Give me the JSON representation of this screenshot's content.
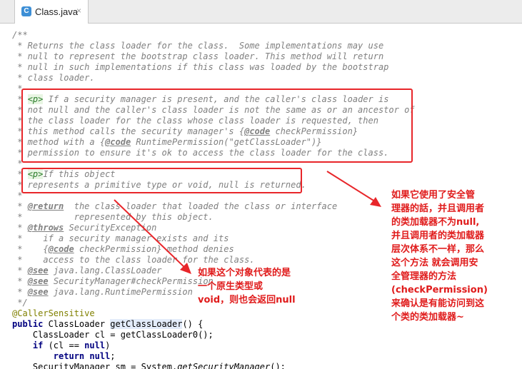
{
  "tab": {
    "label": "Class.java",
    "icon": "java-class-icon",
    "close": "×"
  },
  "code": {
    "l01": "/**",
    "l02": " * Returns the class loader for the class.  Some implementations may use",
    "l03": " * null to represent the bootstrap class loader. This method will return",
    "l04": " * null in such implementations if this class was loaded by the bootstrap",
    "l05": " * class loader.",
    "l06": " *",
    "l07a": " * ",
    "l07tag": "<p>",
    "l07b": " If a security manager is present, and the caller's class loader is",
    "l08": " * not null and the caller's class loader is not the same as or an ancestor of",
    "l09": " * the class loader for the class whose class loader is requested, then",
    "l10a": " * this method calls the security manager's {",
    "l10tag": "@code",
    "l10b": " checkPermission}",
    "l11a": " * method with a {",
    "l11tag": "@code",
    "l11b": " RuntimePermission(\"getClassLoader\")}",
    "l12": " * permission to ensure it's ok to access the class loader for the class.",
    "l13": " *",
    "l14a": " * ",
    "l14tag": "<p>",
    "l14b": "If this object",
    "l15": " * represents a primitive type or void, null is returned.",
    "l16": " *",
    "l17a": " * ",
    "l17tag": "@return",
    "l17b": "  the class loader that loaded the class or interface",
    "l18": " *          represented by this object.",
    "l19a": " * ",
    "l19tag": "@throws",
    "l19b": " SecurityException",
    "l20": " *    if a security manager exists and its",
    "l21a": " *    {",
    "l21tag": "@code",
    "l21b": " checkPermission} method denies",
    "l22": " *    access to the class loader for the class.",
    "l23a": " * ",
    "l23tag": "@see",
    "l23b": " java.lang.ClassLoader",
    "l24a": " * ",
    "l24tag": "@see",
    "l24b": " SecurityManager#checkPermission",
    "l25a": " * ",
    "l25tag": "@see",
    "l25b": " java.lang.RuntimePermission",
    "l26": " */",
    "l27": "@CallerSensitive",
    "l28kw": "public",
    "l28a": " ClassLoader ",
    "l28m": "getClassLoader",
    "l28b": "() {",
    "l29": "    ClassLoader cl = getClassLoader0();",
    "l30a": "    ",
    "l30kw": "if",
    "l30b": " (cl == ",
    "l30kw2": "null",
    "l30c": ")",
    "l31a": "        ",
    "l31kw": "return",
    "l31b": " ",
    "l31kw2": "null",
    "l31c": ";",
    "l32a": "    SecurityManager sm = System.",
    "l32it": "getSecurityManager",
    "l32b": "();"
  },
  "annotations": {
    "right_note": "如果它使用了安全管\n理器的話，并且调用者\n的类加载器不为null,\n并且调用者的类加载器\n层次体系不一样，那么\n这个方法 就会调用安\n全管理器的方法\n(checkPermission)\n来确认是有能访问到这\n个类的类加载器~",
    "center_note": "如果这个对象代表的是\n一个原生类型或\nvoid，则也会返回null"
  }
}
